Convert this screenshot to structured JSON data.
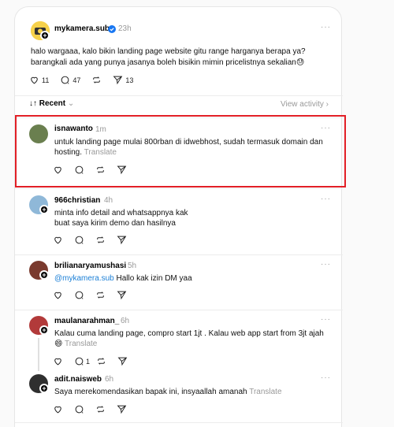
{
  "op": {
    "username": "mykamera.sub",
    "time": "23h",
    "line1": "halo wargaaa, kalo bikin landing page website gitu range harganya berapa ya?",
    "line2": "barangkali ada yang punya jasanya boleh bisikin mimin pricelistnya sekalian",
    "emoji": "😓",
    "likes": "11",
    "comments": "47",
    "shares": "13",
    "more": "···"
  },
  "sort": {
    "label": "↓↑ Recent",
    "chevron": "⌄",
    "view_activity": "View activity",
    "arrow": "›"
  },
  "replies": [
    {
      "username": "isnawanto",
      "time": "1m",
      "line1": "untuk landing page mulai 800rban di idwebhost, sudah termasuk domain dan",
      "line2": "hosting.",
      "translate": "Translate"
    },
    {
      "username": "966christian",
      "time": "4h",
      "line1": "minta info detail and whatsappnya kak",
      "line2": "buat saya kirim demo dan hasilnya"
    },
    {
      "username": "brilianaryamushasi",
      "time": "5h",
      "mention": "@mykamera.sub",
      "line1": " Hallo kak izin DM yaa"
    },
    {
      "username": "maulanarahman_",
      "time": "6h",
      "line1": "Kalau cuma landing page, compro start 1jt . Kalau web app start from 3jt ajah",
      "emoji": "😄",
      "translate": "Translate",
      "comments": "1"
    },
    {
      "username": "adit.naisweb",
      "time": "6h",
      "line1": "Saya merekomendasikan bapak ini, insyaallah amanah",
      "translate": "Translate"
    }
  ],
  "more_label": "···"
}
